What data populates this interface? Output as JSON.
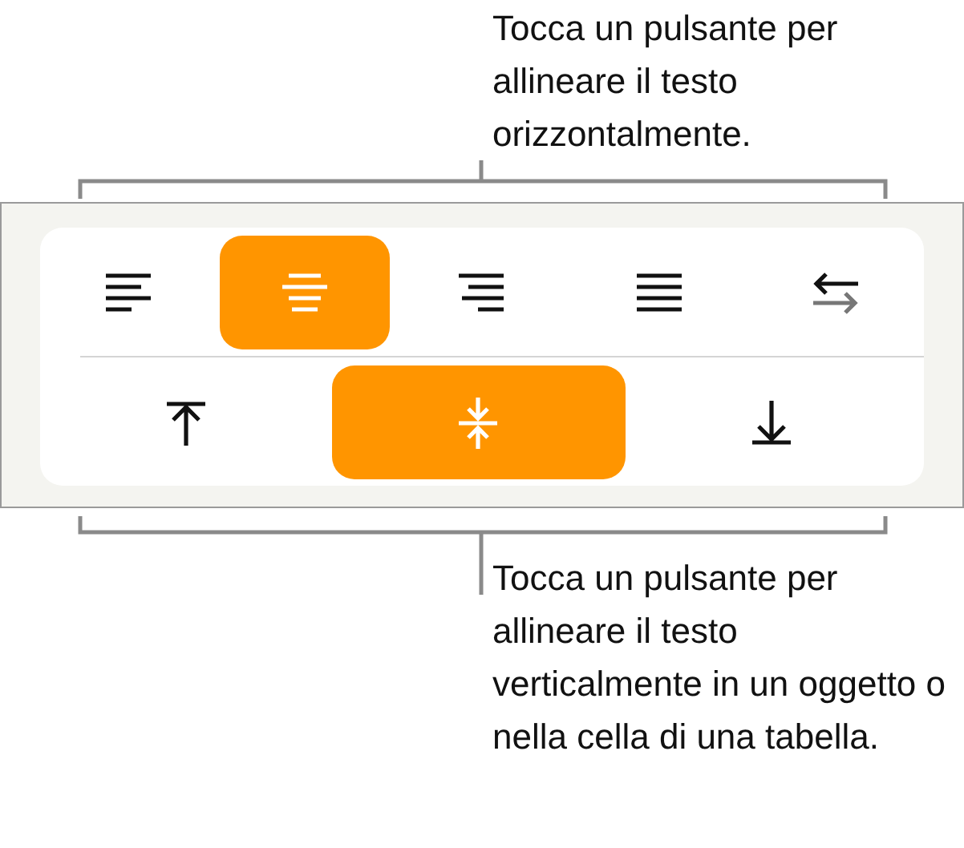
{
  "top_callout": "Tocca un pulsante per allineare il testo orizzontalmente.",
  "horizontal_buttons": [
    {
      "kind": "left",
      "selected": false
    },
    {
      "kind": "center",
      "selected": true
    },
    {
      "kind": "right",
      "selected": false
    },
    {
      "kind": "justify",
      "selected": false
    },
    {
      "kind": "direction",
      "selected": false
    }
  ],
  "vertical_buttons": [
    {
      "kind": "top",
      "selected": false
    },
    {
      "kind": "middle",
      "selected": true
    },
    {
      "kind": "bottom",
      "selected": false
    }
  ],
  "bottom_callout": "Tocca un pulsante per allineare il testo verticalmente in un oggetto o nella cella di una tabella."
}
